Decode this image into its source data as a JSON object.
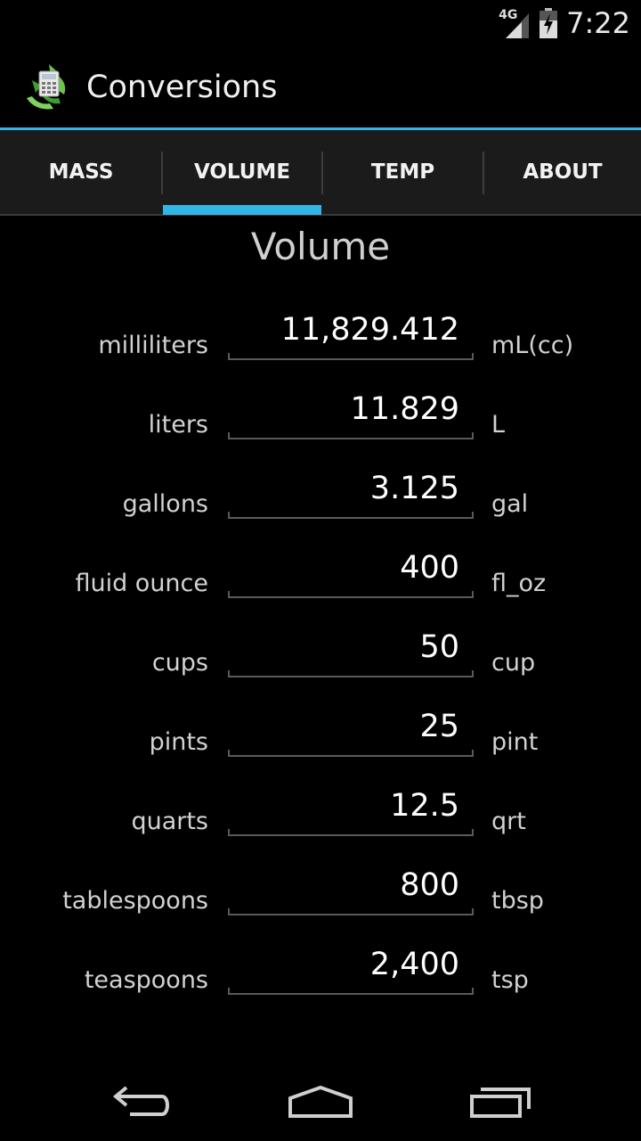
{
  "status_bar": {
    "network_label": "4G",
    "time": "7:22"
  },
  "action_bar": {
    "title": "Conversions"
  },
  "tabs": [
    {
      "label": "MASS",
      "selected": false
    },
    {
      "label": "VOLUME",
      "selected": true
    },
    {
      "label": "TEMP",
      "selected": false
    },
    {
      "label": "ABOUT",
      "selected": false
    }
  ],
  "main": {
    "heading": "Volume",
    "rows": [
      {
        "label": "milliliters",
        "value": "11,829.412",
        "unit": "mL(cc)"
      },
      {
        "label": "liters",
        "value": "11.829",
        "unit": "L"
      },
      {
        "label": "gallons",
        "value": "3.125",
        "unit": "gal"
      },
      {
        "label": "fluid ounce",
        "value": "400",
        "unit": "fl_oz"
      },
      {
        "label": "cups",
        "value": "50",
        "unit": "cup"
      },
      {
        "label": "pints",
        "value": "25",
        "unit": "pint"
      },
      {
        "label": "quarts",
        "value": "12.5",
        "unit": "qrt"
      },
      {
        "label": "tablespoons",
        "value": "800",
        "unit": "tbsp"
      },
      {
        "label": "teaspoons",
        "value": "2,400",
        "unit": "tsp"
      }
    ]
  },
  "nav_bar": {
    "icons": [
      "back-icon",
      "home-icon",
      "recent-apps-icon"
    ]
  },
  "colors": {
    "accent": "#33b5e5",
    "background": "#000000",
    "tab_background": "#1b1b1b"
  }
}
